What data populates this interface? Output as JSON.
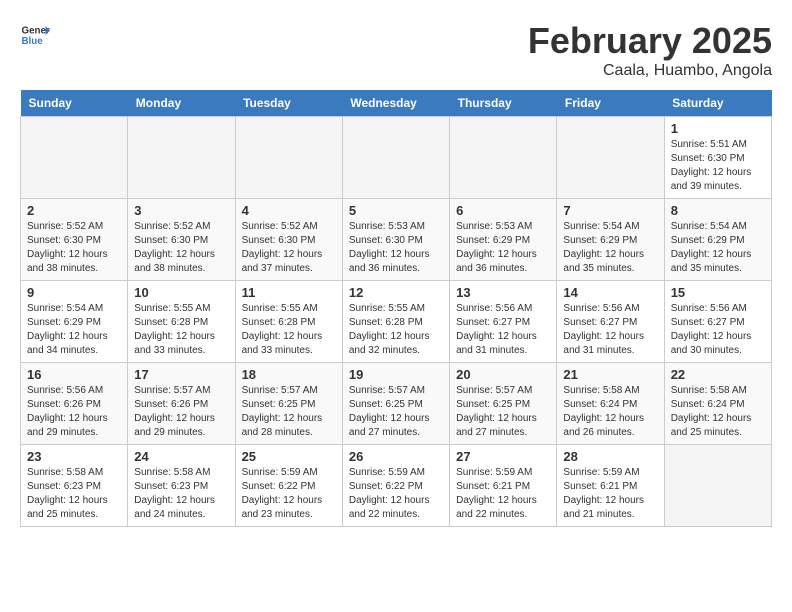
{
  "logo": {
    "line1": "General",
    "line2": "Blue"
  },
  "title": "February 2025",
  "subtitle": "Caala, Huambo, Angola",
  "days_header": [
    "Sunday",
    "Monday",
    "Tuesday",
    "Wednesday",
    "Thursday",
    "Friday",
    "Saturday"
  ],
  "weeks": [
    [
      {
        "day": "",
        "info": ""
      },
      {
        "day": "",
        "info": ""
      },
      {
        "day": "",
        "info": ""
      },
      {
        "day": "",
        "info": ""
      },
      {
        "day": "",
        "info": ""
      },
      {
        "day": "",
        "info": ""
      },
      {
        "day": "1",
        "info": "Sunrise: 5:51 AM\nSunset: 6:30 PM\nDaylight: 12 hours and 39 minutes."
      }
    ],
    [
      {
        "day": "2",
        "info": "Sunrise: 5:52 AM\nSunset: 6:30 PM\nDaylight: 12 hours and 38 minutes."
      },
      {
        "day": "3",
        "info": "Sunrise: 5:52 AM\nSunset: 6:30 PM\nDaylight: 12 hours and 38 minutes."
      },
      {
        "day": "4",
        "info": "Sunrise: 5:52 AM\nSunset: 6:30 PM\nDaylight: 12 hours and 37 minutes."
      },
      {
        "day": "5",
        "info": "Sunrise: 5:53 AM\nSunset: 6:30 PM\nDaylight: 12 hours and 36 minutes."
      },
      {
        "day": "6",
        "info": "Sunrise: 5:53 AM\nSunset: 6:29 PM\nDaylight: 12 hours and 36 minutes."
      },
      {
        "day": "7",
        "info": "Sunrise: 5:54 AM\nSunset: 6:29 PM\nDaylight: 12 hours and 35 minutes."
      },
      {
        "day": "8",
        "info": "Sunrise: 5:54 AM\nSunset: 6:29 PM\nDaylight: 12 hours and 35 minutes."
      }
    ],
    [
      {
        "day": "9",
        "info": "Sunrise: 5:54 AM\nSunset: 6:29 PM\nDaylight: 12 hours and 34 minutes."
      },
      {
        "day": "10",
        "info": "Sunrise: 5:55 AM\nSunset: 6:28 PM\nDaylight: 12 hours and 33 minutes."
      },
      {
        "day": "11",
        "info": "Sunrise: 5:55 AM\nSunset: 6:28 PM\nDaylight: 12 hours and 33 minutes."
      },
      {
        "day": "12",
        "info": "Sunrise: 5:55 AM\nSunset: 6:28 PM\nDaylight: 12 hours and 32 minutes."
      },
      {
        "day": "13",
        "info": "Sunrise: 5:56 AM\nSunset: 6:27 PM\nDaylight: 12 hours and 31 minutes."
      },
      {
        "day": "14",
        "info": "Sunrise: 5:56 AM\nSunset: 6:27 PM\nDaylight: 12 hours and 31 minutes."
      },
      {
        "day": "15",
        "info": "Sunrise: 5:56 AM\nSunset: 6:27 PM\nDaylight: 12 hours and 30 minutes."
      }
    ],
    [
      {
        "day": "16",
        "info": "Sunrise: 5:56 AM\nSunset: 6:26 PM\nDaylight: 12 hours and 29 minutes."
      },
      {
        "day": "17",
        "info": "Sunrise: 5:57 AM\nSunset: 6:26 PM\nDaylight: 12 hours and 29 minutes."
      },
      {
        "day": "18",
        "info": "Sunrise: 5:57 AM\nSunset: 6:25 PM\nDaylight: 12 hours and 28 minutes."
      },
      {
        "day": "19",
        "info": "Sunrise: 5:57 AM\nSunset: 6:25 PM\nDaylight: 12 hours and 27 minutes."
      },
      {
        "day": "20",
        "info": "Sunrise: 5:57 AM\nSunset: 6:25 PM\nDaylight: 12 hours and 27 minutes."
      },
      {
        "day": "21",
        "info": "Sunrise: 5:58 AM\nSunset: 6:24 PM\nDaylight: 12 hours and 26 minutes."
      },
      {
        "day": "22",
        "info": "Sunrise: 5:58 AM\nSunset: 6:24 PM\nDaylight: 12 hours and 25 minutes."
      }
    ],
    [
      {
        "day": "23",
        "info": "Sunrise: 5:58 AM\nSunset: 6:23 PM\nDaylight: 12 hours and 25 minutes."
      },
      {
        "day": "24",
        "info": "Sunrise: 5:58 AM\nSunset: 6:23 PM\nDaylight: 12 hours and 24 minutes."
      },
      {
        "day": "25",
        "info": "Sunrise: 5:59 AM\nSunset: 6:22 PM\nDaylight: 12 hours and 23 minutes."
      },
      {
        "day": "26",
        "info": "Sunrise: 5:59 AM\nSunset: 6:22 PM\nDaylight: 12 hours and 22 minutes."
      },
      {
        "day": "27",
        "info": "Sunrise: 5:59 AM\nSunset: 6:21 PM\nDaylight: 12 hours and 22 minutes."
      },
      {
        "day": "28",
        "info": "Sunrise: 5:59 AM\nSunset: 6:21 PM\nDaylight: 12 hours and 21 minutes."
      },
      {
        "day": "",
        "info": ""
      }
    ]
  ]
}
